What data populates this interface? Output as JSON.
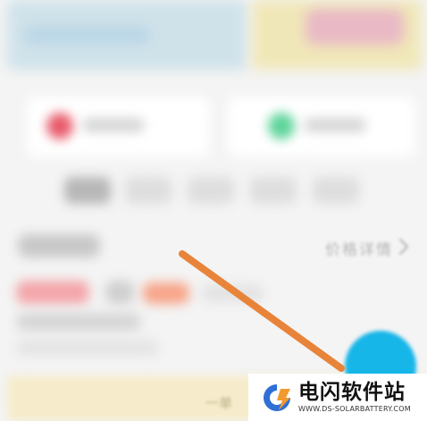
{
  "main": {
    "price_details_label": "价格详情",
    "bottom_partial_text": "一单"
  },
  "watermark": {
    "title": "电闪软件站",
    "subtitle": "WWW.DS-SOLARBATTERY.COM"
  },
  "colors": {
    "fab": "#17b6e8",
    "arrow": "#e8843a",
    "logo_blue": "#2f6fd6",
    "logo_orange": "#f29a2e"
  },
  "icons": {
    "chevron": "chevron-right-icon",
    "logo": "ds-logo-icon"
  }
}
